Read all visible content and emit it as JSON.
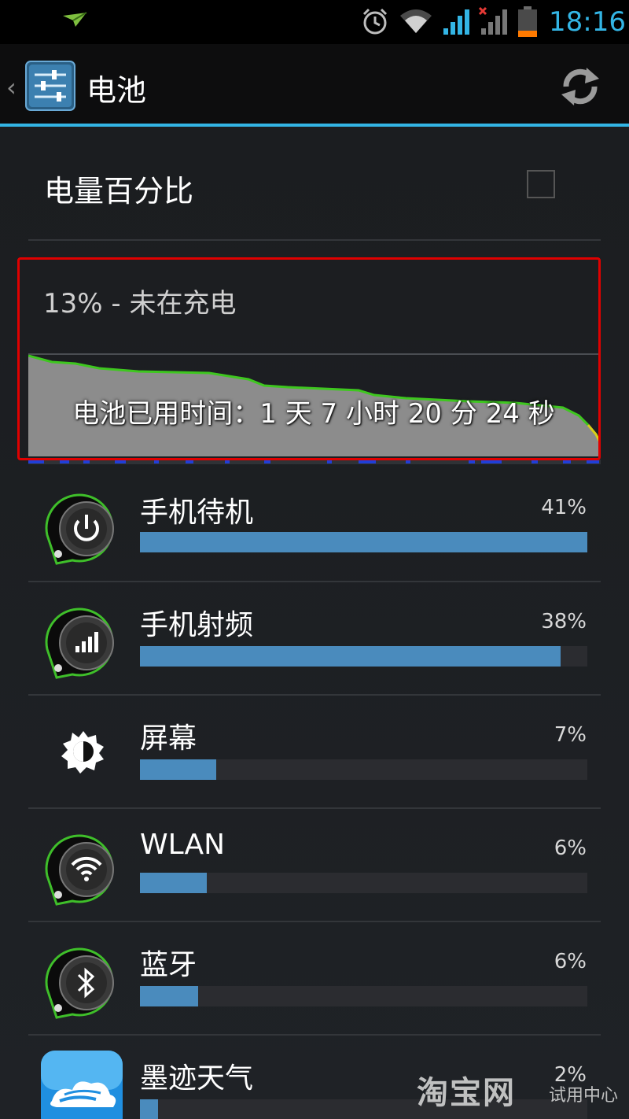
{
  "status_bar": {
    "time": "18:16",
    "icons": [
      "notification-plane-icon",
      "alarm-icon",
      "wifi-icon",
      "signal-icon",
      "signal-no-service-icon",
      "battery-low-icon"
    ]
  },
  "action_bar": {
    "title": "电池",
    "up_icon": "chevron-left-icon",
    "app_icon": "settings-sliders-icon",
    "refresh_icon": "refresh-icon"
  },
  "preference": {
    "title": "电量百分比",
    "checked": false
  },
  "history": {
    "status": "13% - 未在充电",
    "time_on_battery": "电池已用时间：1 天 7 小时 20 分 24 秒",
    "level_trend": [
      0.98,
      0.92,
      0.85,
      0.82,
      0.8,
      0.79,
      0.76,
      0.7,
      0.66,
      0.64,
      0.62,
      0.6,
      0.58,
      0.55,
      0.5,
      0.42,
      0.25,
      0.13
    ]
  },
  "usage": [
    {
      "label": "手机待机",
      "percent": "41%",
      "fraction": 1.0,
      "icon": "power-standby-icon"
    },
    {
      "label": "手机射频",
      "percent": "38%",
      "fraction": 0.94,
      "icon": "cell-signal-icon"
    },
    {
      "label": "屏幕",
      "percent": "7%",
      "fraction": 0.17,
      "icon": "brightness-icon"
    },
    {
      "label": "WLAN",
      "percent": "6%",
      "fraction": 0.15,
      "icon": "wifi-icon"
    },
    {
      "label": "蓝牙",
      "percent": "6%",
      "fraction": 0.13,
      "icon": "bluetooth-icon"
    },
    {
      "label": "墨迹天气",
      "percent": "2%",
      "fraction": 0.04,
      "icon": "weather-app-icon"
    }
  ],
  "watermark": {
    "brand": "淘宝网",
    "sub": "试用中心"
  },
  "colors": {
    "accent": "#33b5e5",
    "bar_fill": "#4a8bbd",
    "highlight_border": "#e00000",
    "graph_line": "#3ec71f"
  }
}
